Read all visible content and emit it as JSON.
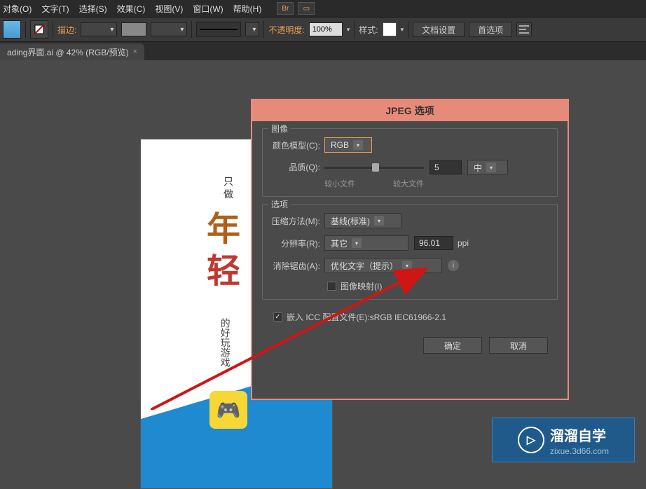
{
  "menu": {
    "items": [
      "对象(O)",
      "文字(T)",
      "选择(S)",
      "效果(C)",
      "视图(V)",
      "窗口(W)",
      "帮助(H)"
    ],
    "icon1": "Br"
  },
  "toolbar": {
    "stroke_label": "描边:",
    "opacity_label": "不透明度:",
    "opacity_value": "100%",
    "style_label": "样式:",
    "doc_setup": "文档设置",
    "preferences": "首选项"
  },
  "tab": {
    "title": "ading界面.ai @ 42% (RGB/预览)"
  },
  "artboard": {
    "line1": "只",
    "line2": "做",
    "big1": "年",
    "big2": "轻",
    "small": "的好玩游戏",
    "controller": "🎮"
  },
  "dialog": {
    "title": "JPEG 选项",
    "image_section": "图像",
    "color_model_label": "颜色模型(C):",
    "color_model_value": "RGB",
    "quality_label": "品质(Q):",
    "quality_value": "5",
    "quality_preset": "中",
    "smaller_file": "较小文件",
    "larger_file": "较大文件",
    "options_section": "选项",
    "compression_label": "压缩方法(M):",
    "compression_value": "基线(标准)",
    "resolution_label": "分辨率(R):",
    "resolution_preset": "其它",
    "resolution_value": "96.01",
    "resolution_unit": "ppi",
    "antialias_label": "消除锯齿(A):",
    "antialias_value": "优化文字（提示）",
    "imagemap_label": "图像映射(I)",
    "embed_label": "嵌入 ICC 配置文件(E):",
    "embed_profile": "sRGB IEC61966-2.1",
    "ok": "确定",
    "cancel": "取消"
  },
  "watermark": {
    "title": "溜溜自学",
    "sub": "zixue.3d66.com"
  }
}
